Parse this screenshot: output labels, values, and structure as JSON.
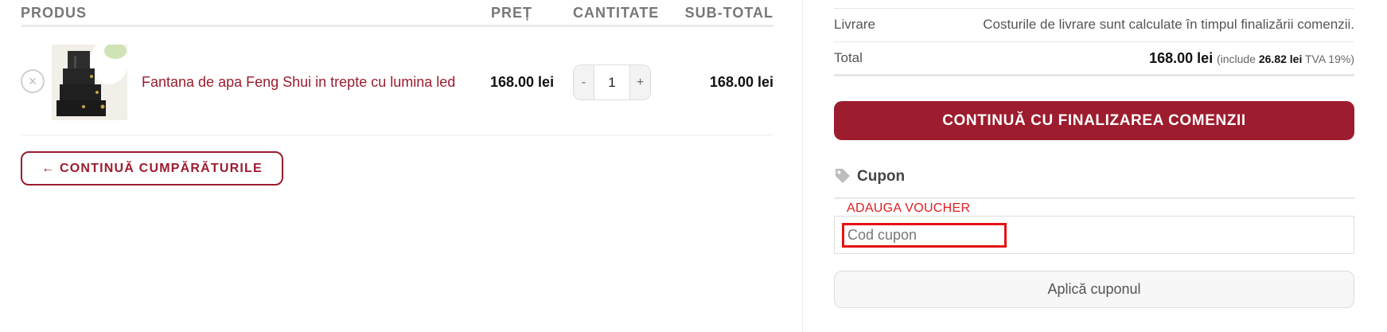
{
  "cart": {
    "headers": {
      "product": "PRODUS",
      "price": "PREȚ",
      "quantity": "CANTITATE",
      "subtotal": "SUB-TOTAL"
    },
    "items": [
      {
        "remove_icon": "×",
        "name": "Fantana de apa Feng Shui in trepte cu lumina led",
        "price": "168.00 lei",
        "quantity": "1",
        "qty_minus": "-",
        "qty_plus": "+",
        "subtotal": "168.00 lei"
      }
    ],
    "continue_shopping": "← CONTINUĂ CUMPĂRĂTURILE"
  },
  "totals": {
    "shipping_label": "Livrare",
    "shipping_value": "Costurile de livrare sunt calculate în timpul finalizării comenzii.",
    "total_label": "Total",
    "total_value": "168.00 lei",
    "tax_prefix": "(include",
    "tax_amount": "26.82 lei",
    "tax_suffix": "TVA 19%)"
  },
  "checkout": {
    "button_label": "CONTINUĂ CU FINALIZAREA COMENZII"
  },
  "coupon": {
    "title": "Cupon",
    "annotation": "ADAUGA VOUCHER",
    "placeholder": "Cod cupon",
    "apply_label": "Aplică cuponul"
  },
  "colors": {
    "accent": "#9d1c2e",
    "annotation_red": "#e61212"
  },
  "icons": {
    "remove": "close-circle-icon",
    "coupon": "tag-icon"
  }
}
